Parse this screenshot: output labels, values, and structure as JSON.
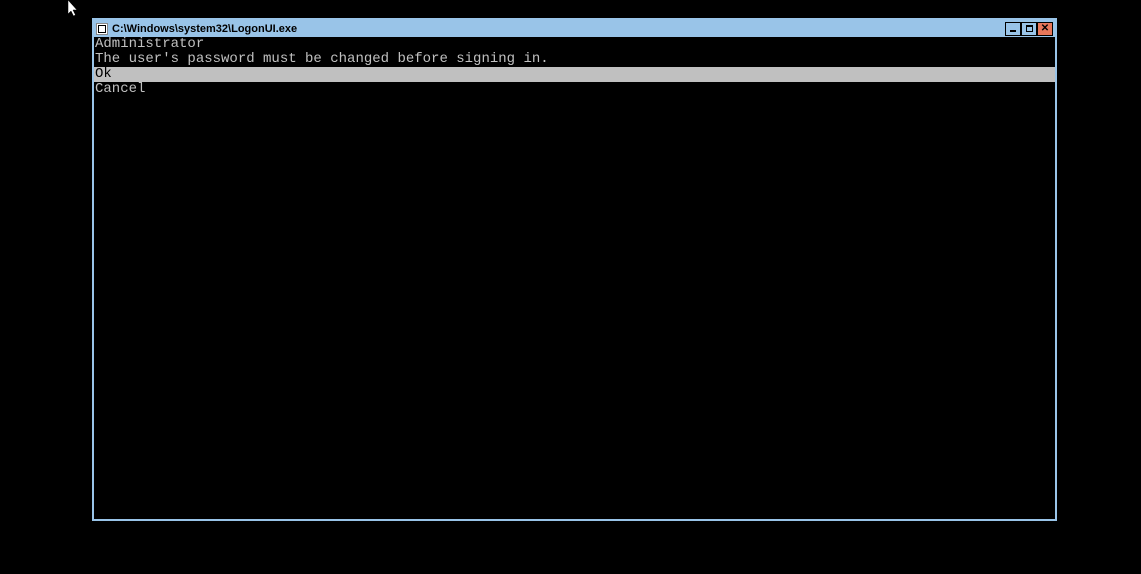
{
  "window": {
    "title": "C:\\Windows\\system32\\LogonUI.exe"
  },
  "content": {
    "username": "Administrator",
    "message": "The user's password must be changed before signing in.",
    "ok_label": "Ok",
    "cancel_label": "Cancel"
  }
}
